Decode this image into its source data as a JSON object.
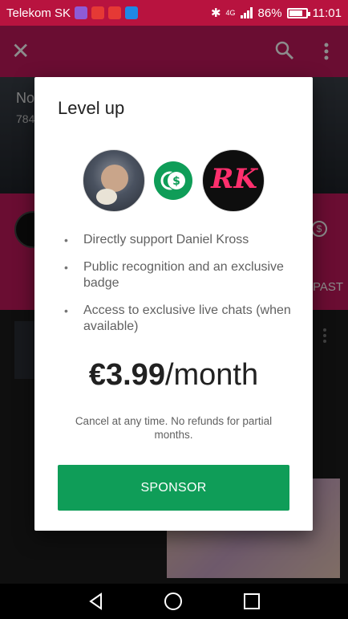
{
  "status_bar": {
    "carrier": "Telekom SK",
    "network": "4G",
    "battery": "86%",
    "time": "11:01",
    "app_chip_colors": [
      "#8e5bd6",
      "#e53935",
      "#e53935",
      "#1e88e5"
    ]
  },
  "app_bar": {
    "close_icon": "close-icon",
    "search_icon": "search-icon",
    "more_icon": "more-vert-icon"
  },
  "background": {
    "title_fragment": "No",
    "count_fragment": "784",
    "past_label": "PAST"
  },
  "dialog": {
    "title": "Level up",
    "perks": [
      "Directly support Daniel Kross",
      "Public recognition and an exclusive badge",
      "Access to exclusive live chats (when available)"
    ],
    "price_amount": "€3.99",
    "price_period": "/month",
    "note": "Cancel at any time. No refunds for partial months.",
    "button_label": "SPONSOR",
    "channel_logo_text": "RK"
  },
  "colors": {
    "brand": "#c2185b",
    "accent": "#0f9d58"
  }
}
